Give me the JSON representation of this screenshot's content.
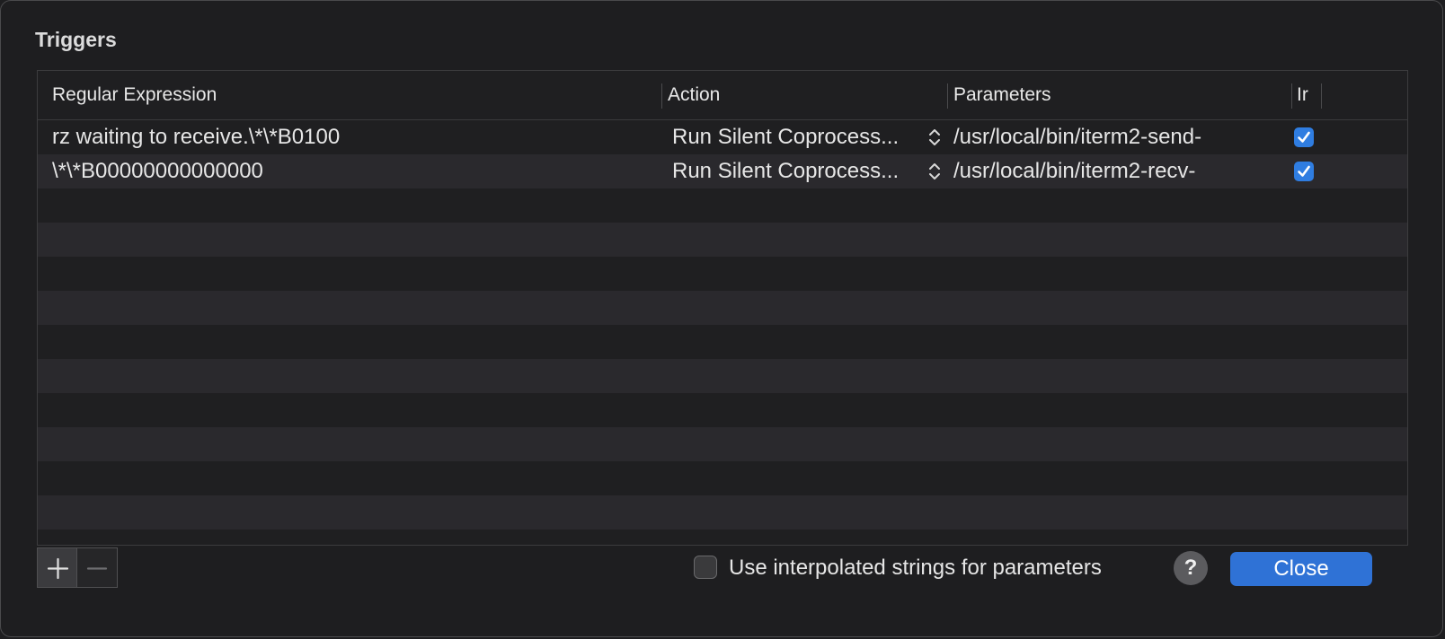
{
  "dialog": {
    "title": "Triggers"
  },
  "table": {
    "columns": [
      {
        "label": "Regular Expression"
      },
      {
        "label": "Action"
      },
      {
        "label": "Parameters"
      },
      {
        "label": "Ir"
      }
    ],
    "rows": [
      {
        "regex": "rz waiting to receive.\\*\\*B0100",
        "action": "Run Silent Coprocess...",
        "parameters": "/usr/local/bin/iterm2-send-",
        "enabled": true
      },
      {
        "regex": "\\*\\*B00000000000000",
        "action": "Run Silent Coprocess...",
        "parameters": "/usr/local/bin/iterm2-recv-",
        "enabled": true
      }
    ]
  },
  "footer": {
    "add_icon": "plus-icon",
    "remove_icon": "minus-icon",
    "interpolated_label": "Use interpolated strings for parameters",
    "interpolated_checked": false,
    "help_label": "?",
    "close_label": "Close"
  },
  "colors": {
    "accent": "#2f72d6",
    "checkbox_on": "#2f7de1",
    "row_alt": "#2a292d",
    "background": "#1e1e20"
  }
}
